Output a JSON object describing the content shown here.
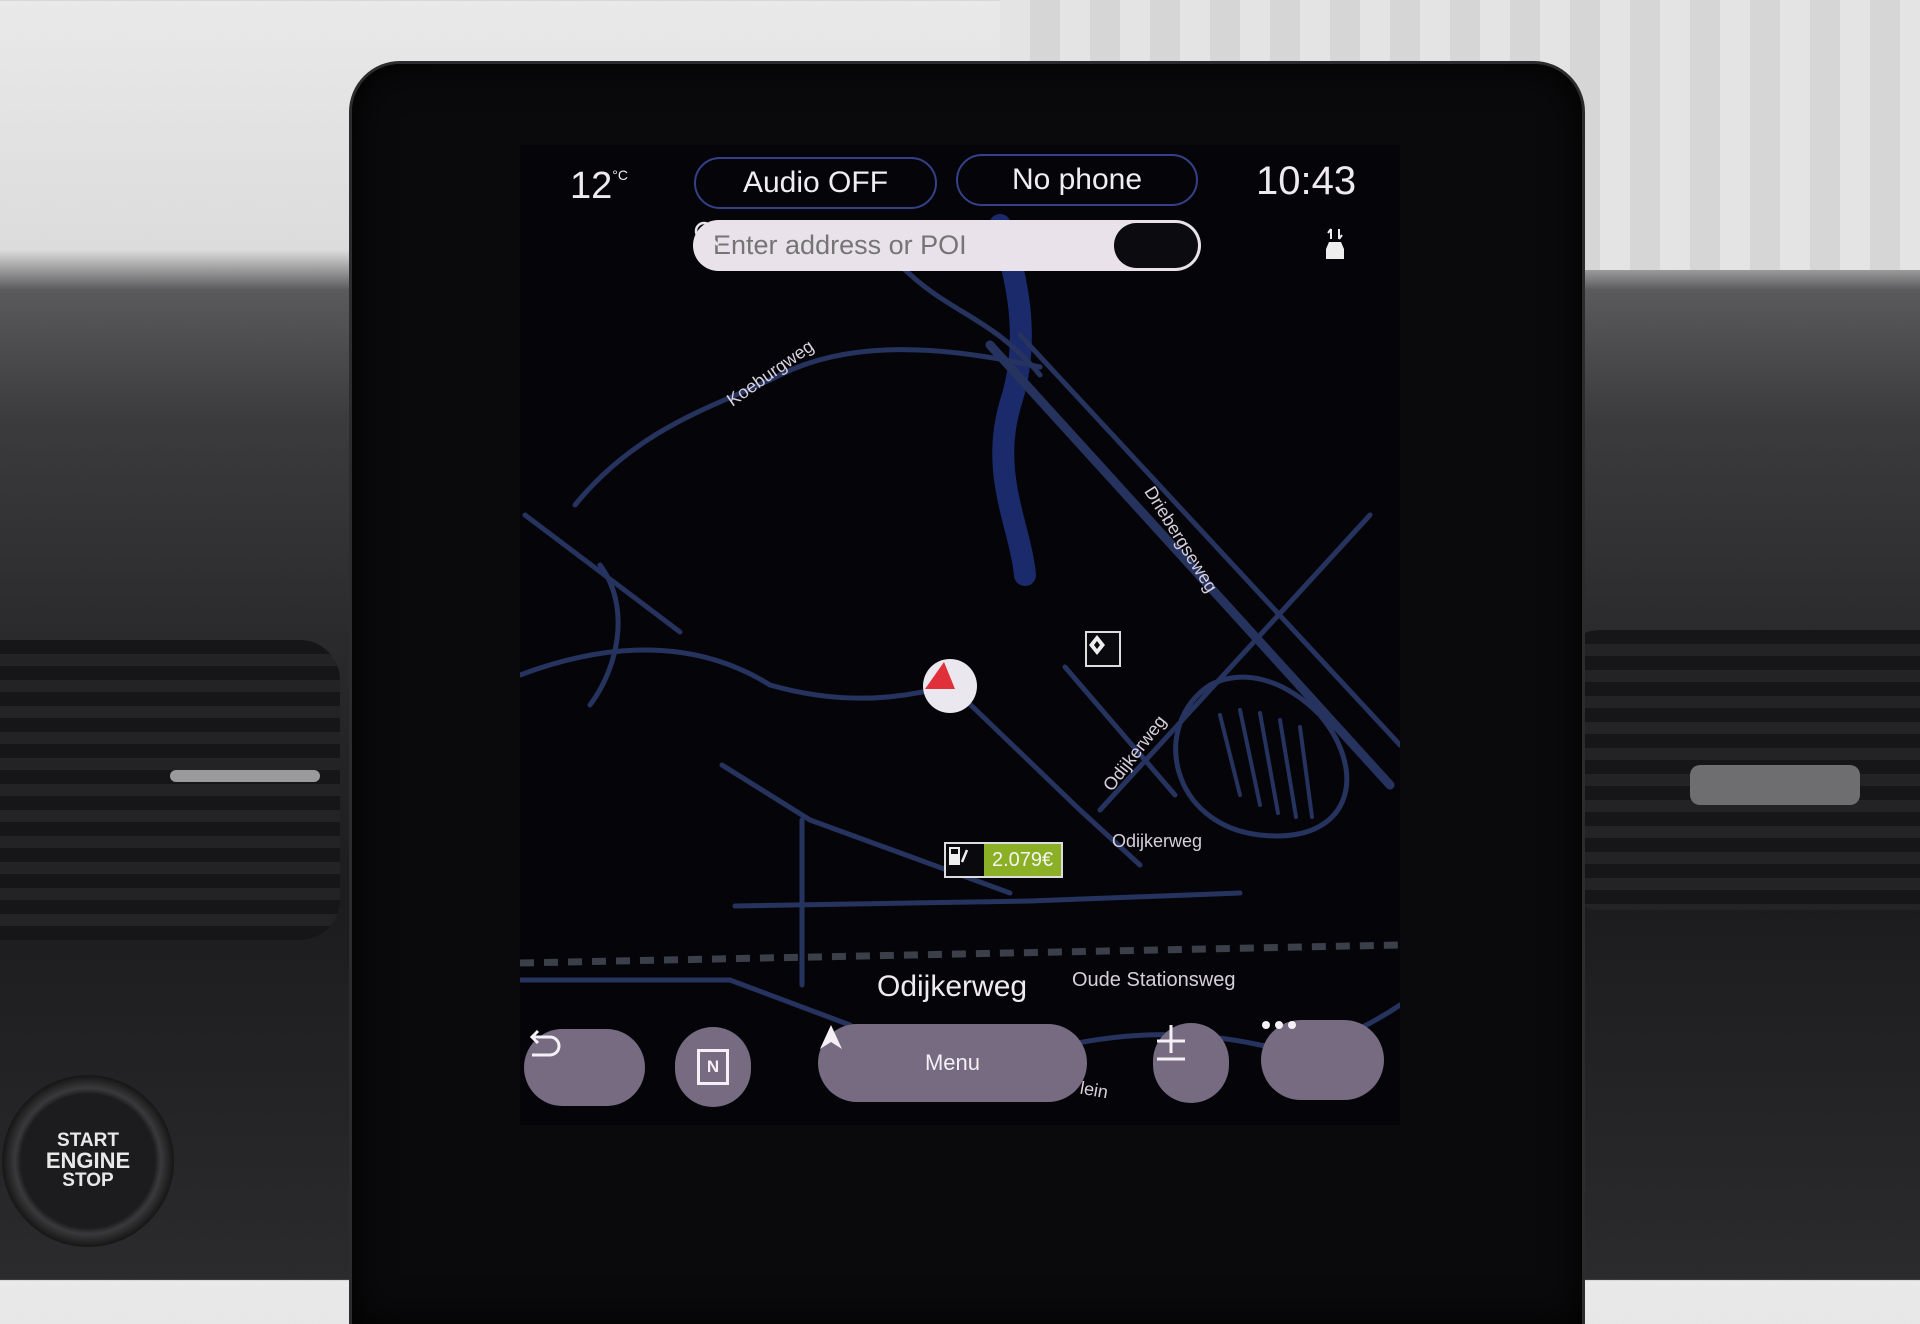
{
  "status_bar": {
    "temperature": "12",
    "temperature_unit": "°C",
    "audio_button": "Audio OFF",
    "phone_button": "No phone",
    "time": "10:43"
  },
  "search": {
    "placeholder": "Enter address or POI",
    "icon": "search-icon"
  },
  "map": {
    "road_labels": {
      "koeburgweg": "Koeburgweg",
      "driebergseweg": "Driebergseweg",
      "odijkerweg_diag": "Odijkerweg",
      "odijkerweg": "Odijkerweg",
      "oude_stationsweg": "Oude Stationsweg",
      "partial": "lein"
    },
    "current_street": "Odijkerweg",
    "fuel_price": "2.079€",
    "colors": {
      "road": "#25335e",
      "river": "#1a2a6a",
      "vehicle_arrow": "#e0303a",
      "fuel_badge": "#8bb026"
    }
  },
  "nav_buttons": {
    "back": "back-icon",
    "compass": "N",
    "menu_label": "Menu",
    "zoom": "zoom-icon",
    "more": "more-icon"
  },
  "system_bar": [
    "power-icon",
    "apps-icon",
    "home-icon",
    "volume-down-icon",
    "volume-up-icon"
  ],
  "car": {
    "start_button": [
      "START",
      "ENGINE",
      "STOP"
    ]
  },
  "colors": {
    "pill_border": "#34418a",
    "button_bg": "#766b80",
    "search_bg": "#e9e2ea"
  }
}
